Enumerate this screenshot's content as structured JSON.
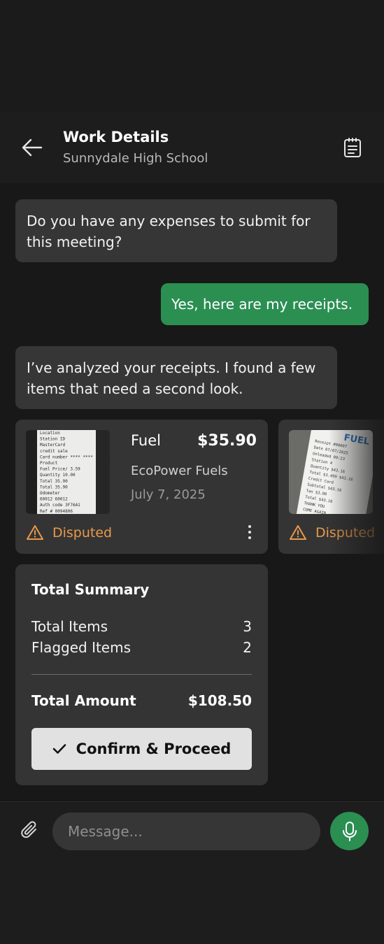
{
  "header": {
    "title": "Work Details",
    "subtitle": "Sunnydale High School",
    "back_icon": "arrow-left-icon",
    "notes_icon": "clipboard-list-icon"
  },
  "messages": [
    {
      "from": "assistant",
      "text": "Do you have any expenses to submit for this meeting?"
    },
    {
      "from": "user",
      "text": "Yes, here are my receipts."
    },
    {
      "from": "assistant",
      "text": "I’ve analyzed your receipts. I found a few items that need a second look."
    }
  ],
  "receipts": [
    {
      "category": "Fuel",
      "amount": "$35.90",
      "vendor": "EcoPower Fuels",
      "date": "July 7, 2025",
      "status": "Disputed",
      "thumb_lines": [
        "Location",
        "Station ID",
        "MasterCard",
        "credit sale",
        "Card number **** **** *** 1234",
        "Product",
        "Fuel      Price/    3.59",
        "Quantity            10.00",
        "Total               35.90",
        "Total               35.90",
        "Odometer",
        "60012               60012",
        "Auth code  3F76A1",
        "Ref # 0094806"
      ]
    },
    {
      "status": "Disputed",
      "thumb_brand": "FUEL",
      "thumb_lines": [
        "Receipt #00007",
        "Date        07/07/2025",
        "Unleaded        09:23",
        "Station 4",
        "Quantity        $43.16",
        "Total    $3.499  $43.16",
        "Credit Card",
        "Subtotal        $43.16",
        "Tax             $3.00",
        "Total           $43.16",
        "THANK YOU",
        "COME AGAIN"
      ]
    }
  ],
  "summary": {
    "title": "Total Summary",
    "rows": [
      {
        "label": "Total Items",
        "value": "3"
      },
      {
        "label": "Flagged Items",
        "value": "2"
      }
    ],
    "total_label": "Total Amount",
    "total_value": "$108.50",
    "confirm_label": "Confirm & Proceed"
  },
  "composer": {
    "placeholder": "Message...",
    "attach_icon": "paperclip-icon",
    "mic_icon": "microphone-icon"
  },
  "colors": {
    "accent_green": "#2b8f52",
    "warning_orange": "#e89a4a",
    "bubble_gray": "#363636",
    "card_gray": "#343434"
  }
}
